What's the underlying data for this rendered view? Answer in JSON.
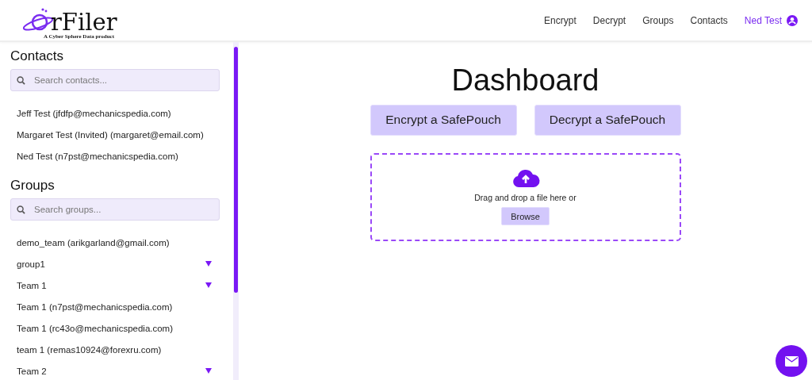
{
  "logo": {
    "name": "rFiler",
    "tagline": "A Cyber Sphere Data product"
  },
  "nav": [
    {
      "label": "Encrypt",
      "kind": "link"
    },
    {
      "label": "Decrypt",
      "kind": "link"
    },
    {
      "label": "Groups",
      "kind": "link"
    },
    {
      "label": "Contacts",
      "kind": "link"
    },
    {
      "label": "Ned Test",
      "kind": "user"
    }
  ],
  "sidebar": {
    "contacts": {
      "title": "Contacts",
      "placeholder": "Search contacts...",
      "items": [
        "Jeff Test (jfdfp@mechanicspedia.com)",
        "Margaret Test (Invited) (margaret@email.com)",
        "Ned Test (n7pst@mechanicspedia.com)"
      ]
    },
    "groups": {
      "title": "Groups",
      "placeholder": "Search groups...",
      "items": [
        {
          "label": "demo_team (arikgarland@gmail.com)",
          "expandable": false
        },
        {
          "label": "group1",
          "expandable": true
        },
        {
          "label": "Team 1",
          "expandable": true
        },
        {
          "label": "Team 1 (n7pst@mechanicspedia.com)",
          "expandable": false
        },
        {
          "label": "Team 1 (rc43o@mechanicspedia.com)",
          "expandable": false
        },
        {
          "label": "team 1 (remas10924@forexru.com)",
          "expandable": false
        },
        {
          "label": "Team 2",
          "expandable": true
        }
      ]
    }
  },
  "main": {
    "title": "Dashboard",
    "actions": [
      "Encrypt a SafePouch",
      "Decrypt a SafePouch"
    ],
    "dropzone": {
      "text": "Drag and drop a file here or",
      "button": "Browse"
    }
  }
}
